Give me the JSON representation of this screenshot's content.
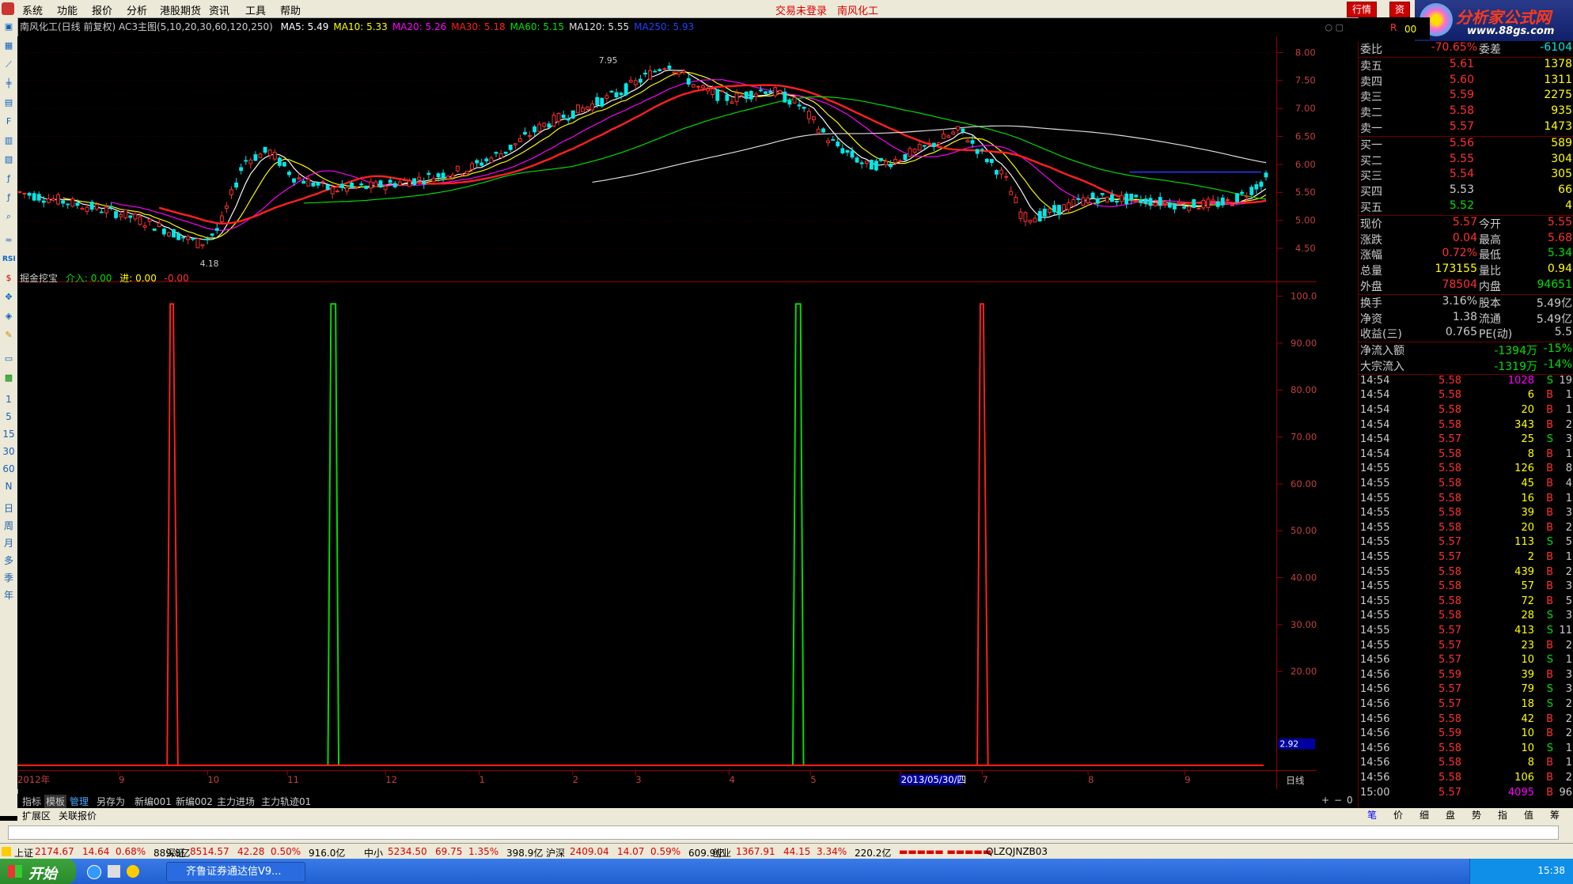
{
  "menu": [
    "系统",
    "功能",
    "报价",
    "分析",
    "港股期货",
    "资讯",
    "工具",
    "帮助"
  ],
  "center_status": "交易未登录",
  "stock_name_top": "南风化工",
  "top_buttons": [
    "行情",
    "资"
  ],
  "logo": {
    "line1": "分析家公式网",
    "line2": "www.88gs.com"
  },
  "left_tools_text": [
    "1",
    "5",
    "15",
    "30",
    "60",
    "N",
    "日",
    "周",
    "月",
    "多",
    "季",
    "年"
  ],
  "main_legend": {
    "title": "南风化工(日线 前复权) AC3主图(5,10,20,30,60,120,250)",
    "ma": [
      {
        "label": "MA5: 5.49",
        "color": "#ffffff"
      },
      {
        "label": "MA10: 5.33",
        "color": "#ffff00"
      },
      {
        "label": "MA20: 5.26",
        "color": "#ff00ff"
      },
      {
        "label": "MA30: 5.18",
        "color": "#ff2020"
      },
      {
        "label": "MA60: 5.15",
        "color": "#00e000"
      },
      {
        "label": "MA120: 5.55",
        "color": "#e0e0e0"
      },
      {
        "label": "MA250: 5.93",
        "color": "#2040ff"
      }
    ]
  },
  "price_axis": [
    "8.00",
    "7.50",
    "7.00",
    "6.50",
    "6.00",
    "5.50",
    "5.00",
    "4.50"
  ],
  "price_annotations": {
    "high": "7.95",
    "low": "4.18"
  },
  "sub_legend": {
    "title": "掘金挖宝",
    "in_label": "介入: 0.00",
    "jin_label": "进: 0.00",
    "neg_label": "-0.00"
  },
  "sub_axis": [
    "100.0",
    "90.00",
    "80.00",
    "70.00",
    "60.00",
    "50.00",
    "40.00",
    "30.00",
    "20.00"
  ],
  "sub_value_box": "2.92",
  "x_labels": [
    "2012年",
    "9",
    "10",
    "11",
    "12",
    "1",
    "2",
    "3",
    "4",
    "5",
    "2013/05/30/四",
    "7",
    "8",
    "9"
  ],
  "period_label": "日线",
  "bottom_tabs": [
    "指标",
    "模板",
    "管理",
    "另存为",
    "新编001",
    "新编002",
    "主力进场",
    "主力轨迹01"
  ],
  "bottom_tabs2": [
    "扩展区",
    "关联报价"
  ],
  "zoom_buttons": [
    "+",
    "−",
    "0"
  ],
  "panel": {
    "weibi": {
      "label": "委比",
      "value": "-70.65%",
      "label2": "委差",
      "value2": "-6104"
    },
    "sell": [
      {
        "label": "卖五",
        "price": "5.61",
        "vol": "1378"
      },
      {
        "label": "卖四",
        "price": "5.60",
        "vol": "1311"
      },
      {
        "label": "卖三",
        "price": "5.59",
        "vol": "2275"
      },
      {
        "label": "卖二",
        "price": "5.58",
        "vol": "935"
      },
      {
        "label": "卖一",
        "price": "5.57",
        "vol": "1473"
      }
    ],
    "buy": [
      {
        "label": "买一",
        "price": "5.56",
        "vol": "589"
      },
      {
        "label": "买二",
        "price": "5.55",
        "vol": "304"
      },
      {
        "label": "买三",
        "price": "5.54",
        "vol": "305"
      },
      {
        "label": "买四",
        "price": "5.53",
        "vol": "66"
      },
      {
        "label": "买五",
        "price": "5.52",
        "vol": "4"
      }
    ],
    "quote": [
      {
        "l1": "现价",
        "v1": "5.57",
        "l2": "今开",
        "v2": "5.55"
      },
      {
        "l1": "涨跌",
        "v1": "0.04",
        "l2": "最高",
        "v2": "5.68"
      },
      {
        "l1": "涨幅",
        "v1": "0.72%",
        "l2": "最低",
        "v2": "5.34"
      },
      {
        "l1": "总量",
        "v1": "173155",
        "l2": "量比",
        "v2": "0.94"
      },
      {
        "l1": "外盘",
        "v1": "78504",
        "l2": "内盘",
        "v2": "94651"
      }
    ],
    "fund": [
      {
        "l1": "换手",
        "v1": "3.16%",
        "l2": "股本",
        "v2": "5.49亿"
      },
      {
        "l1": "净资",
        "v1": "1.38",
        "l2": "流通",
        "v2": "5.49亿"
      },
      {
        "l1": "收益(三)",
        "v1": "0.765",
        "l2": "PE(动)",
        "v2": "5.5"
      }
    ],
    "flow": [
      {
        "label": "净流入额",
        "value": "-1394万",
        "pct": "-15%"
      },
      {
        "label": "大宗流入",
        "value": "-1319万",
        "pct": "-14%"
      }
    ],
    "ticks": [
      {
        "t": "14:54",
        "p": "5.58",
        "v": "1028",
        "d": "S",
        "n": "19"
      },
      {
        "t": "14:54",
        "p": "5.58",
        "v": "6",
        "d": "B",
        "n": "1"
      },
      {
        "t": "14:54",
        "p": "5.58",
        "v": "20",
        "d": "B",
        "n": "1"
      },
      {
        "t": "14:54",
        "p": "5.58",
        "v": "343",
        "d": "B",
        "n": "2"
      },
      {
        "t": "14:54",
        "p": "5.57",
        "v": "25",
        "d": "S",
        "n": "3"
      },
      {
        "t": "14:54",
        "p": "5.58",
        "v": "8",
        "d": "B",
        "n": "1"
      },
      {
        "t": "14:55",
        "p": "5.58",
        "v": "126",
        "d": "B",
        "n": "8"
      },
      {
        "t": "14:55",
        "p": "5.58",
        "v": "45",
        "d": "B",
        "n": "4"
      },
      {
        "t": "14:55",
        "p": "5.58",
        "v": "16",
        "d": "B",
        "n": "1"
      },
      {
        "t": "14:55",
        "p": "5.58",
        "v": "39",
        "d": "B",
        "n": "3"
      },
      {
        "t": "14:55",
        "p": "5.58",
        "v": "20",
        "d": "B",
        "n": "2"
      },
      {
        "t": "14:55",
        "p": "5.57",
        "v": "113",
        "d": "S",
        "n": "5"
      },
      {
        "t": "14:55",
        "p": "5.57",
        "v": "2",
        "d": "B",
        "n": "1"
      },
      {
        "t": "14:55",
        "p": "5.58",
        "v": "439",
        "d": "B",
        "n": "2"
      },
      {
        "t": "14:55",
        "p": "5.58",
        "v": "57",
        "d": "B",
        "n": "3"
      },
      {
        "t": "14:55",
        "p": "5.58",
        "v": "72",
        "d": "B",
        "n": "5"
      },
      {
        "t": "14:55",
        "p": "5.58",
        "v": "28",
        "d": "S",
        "n": "3"
      },
      {
        "t": "14:55",
        "p": "5.57",
        "v": "413",
        "d": "S",
        "n": "11"
      },
      {
        "t": "14:55",
        "p": "5.57",
        "v": "23",
        "d": "B",
        "n": "2"
      },
      {
        "t": "14:56",
        "p": "5.57",
        "v": "10",
        "d": "S",
        "n": "1"
      },
      {
        "t": "14:56",
        "p": "5.59",
        "v": "39",
        "d": "B",
        "n": "3"
      },
      {
        "t": "14:56",
        "p": "5.57",
        "v": "79",
        "d": "S",
        "n": "3"
      },
      {
        "t": "14:56",
        "p": "5.57",
        "v": "18",
        "d": "S",
        "n": "2"
      },
      {
        "t": "14:56",
        "p": "5.58",
        "v": "42",
        "d": "B",
        "n": "2"
      },
      {
        "t": "14:56",
        "p": "5.59",
        "v": "10",
        "d": "B",
        "n": "2"
      },
      {
        "t": "14:56",
        "p": "5.58",
        "v": "10",
        "d": "S",
        "n": "1"
      },
      {
        "t": "14:56",
        "p": "5.58",
        "v": "8",
        "d": "B",
        "n": "1"
      },
      {
        "t": "14:56",
        "p": "5.58",
        "v": "106",
        "d": "B",
        "n": "2"
      },
      {
        "t": "15:00",
        "p": "5.57",
        "v": "4095",
        "d": "B",
        "n": "96"
      }
    ],
    "tabs": [
      "笔",
      "价",
      "细",
      "盘",
      "势",
      "指",
      "值",
      "筹"
    ]
  },
  "status_bar": [
    {
      "name": "上证",
      "price": "2174.67",
      "chg": "14.64",
      "pct": "0.68%",
      "amt": "889.8亿"
    },
    {
      "name": "深证",
      "price": "8514.57",
      "chg": "42.28",
      "pct": "0.50%",
      "amt": "916.0亿"
    },
    {
      "name": "中小",
      "price": "5234.50",
      "chg": "69.75",
      "pct": "1.35%",
      "amt": "398.9亿"
    },
    {
      "name": "沪深",
      "price": "2409.04",
      "chg": "14.07",
      "pct": "0.59%",
      "amt": "609.9亿"
    },
    {
      "name": "创业",
      "price": "1367.91",
      "chg": "44.15",
      "pct": "3.34%",
      "amt": "220.2亿"
    }
  ],
  "status_code": "QLZQJNZB03",
  "taskbar": {
    "start": "开始",
    "task": "齐鲁证券通达信V9...",
    "time": "15:38"
  },
  "colors": {
    "up": "#ff3030",
    "down": "#00e8e8",
    "green": "#00e000",
    "axis": "#a00000"
  },
  "chart_data": {
    "type": "candlestick",
    "y_range": [
      4.18,
      8.0
    ],
    "x_period": "2012年 ~ 2013",
    "signals": [
      {
        "x_index": 0.122,
        "color": "red",
        "value": 100
      },
      {
        "x_index": 0.251,
        "color": "green",
        "value": 100
      },
      {
        "x_index": 0.624,
        "color": "green",
        "value": 100
      },
      {
        "x_index": 0.772,
        "color": "red",
        "value": 100
      }
    ],
    "sub_range": [
      0,
      100
    ]
  }
}
